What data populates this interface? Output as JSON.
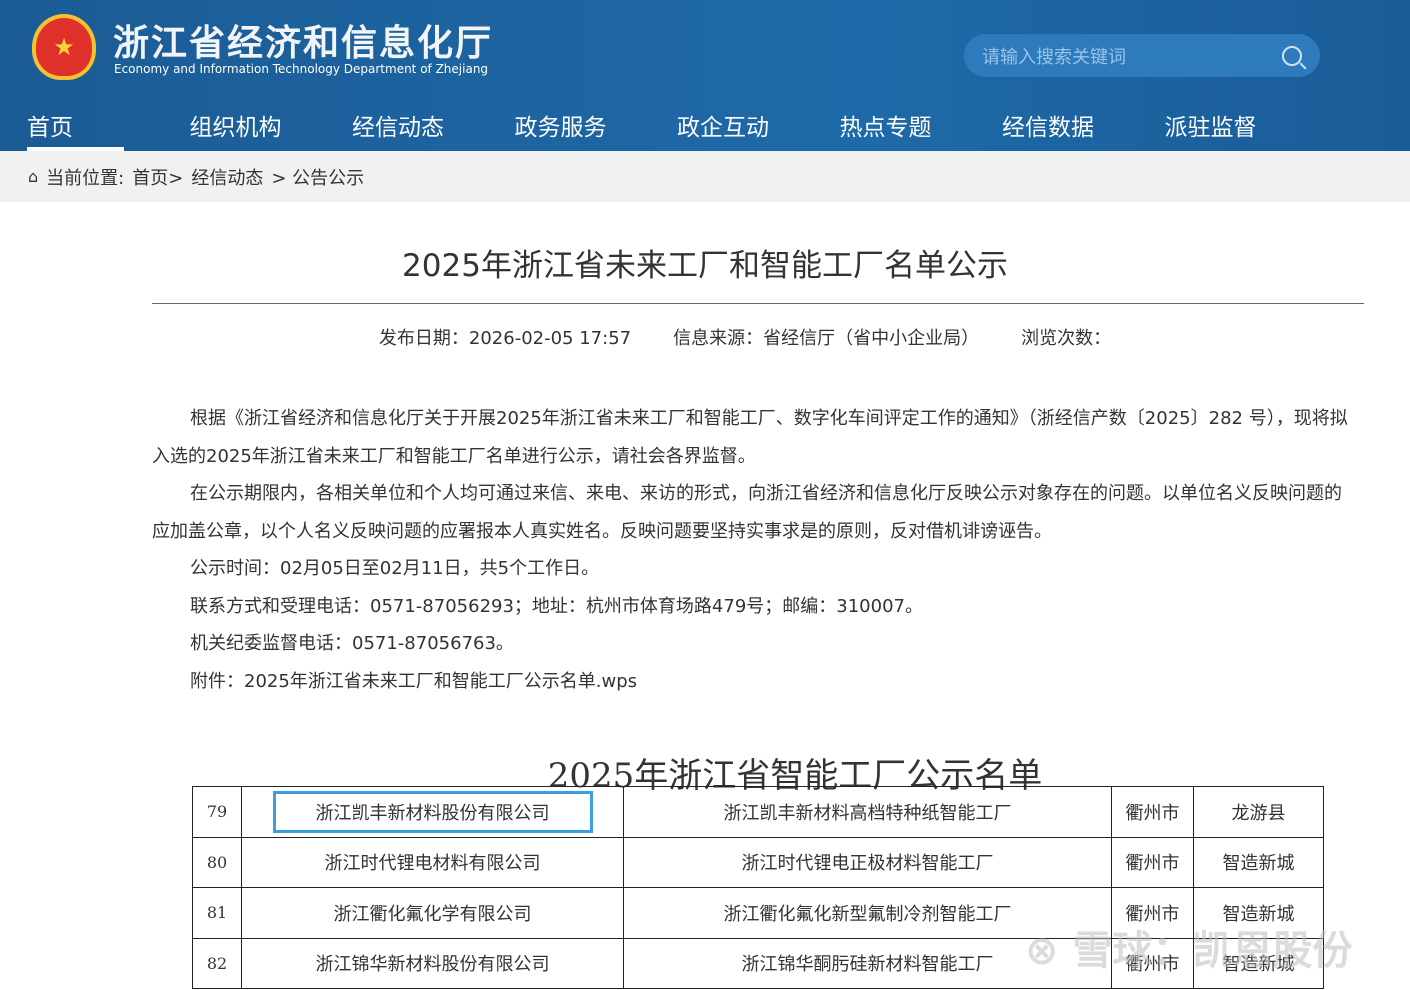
{
  "header": {
    "title": "浙江省经济和信息化厅",
    "subtitle": "Economy and Information Technology Department of Zhejiang",
    "search_placeholder": "请输入搜索关键词"
  },
  "nav": [
    "首页",
    "组织机构",
    "经信动态",
    "政务服务",
    "政企互动",
    "热点专题",
    "经信数据",
    "派驻监督"
  ],
  "breadcrumb": {
    "label": "当前位置:",
    "items": [
      "首页>",
      "经信动态",
      "> 公告公示"
    ]
  },
  "article": {
    "title": "2025年浙江省未来工厂和智能工厂名单公示",
    "date": "发布日期：2026-02-05 17:57",
    "source": "信息来源：省经信厅（省中小企业局）",
    "views": "浏览次数：",
    "paragraphs": [
      "根据《浙江省经济和信息化厅关于开展2025年浙江省未来工厂和智能工厂、数字化车间评定工作的通知》（浙经信产数〔2025〕282 号），现将拟入选的2025年浙江省未来工厂和智能工厂名单进行公示，请社会各界监督。",
      "在公示期限内，各相关单位和个人均可通过来信、来电、来访的形式，向浙江省经济和信息化厅反映公示对象存在的问题。以单位名义反映问题的应加盖公章，以个人名义反映问题的应署报本人真实姓名。反映问题要坚持实事求是的原则，反对借机诽谤诬告。",
      "公示时间：02月05日至02月11日，共5个工作日。",
      "联系方式和受理电话：0571-87056293；地址：杭州市体育场路479号；邮编：310007。",
      "机关纪委监督电话：0571-87056763。",
      "附件：2025年浙江省未来工厂和智能工厂公示名单.wps"
    ]
  },
  "list": {
    "title": "2025年浙江省智能工厂公示名单",
    "rows": [
      [
        "79",
        "浙江凯丰新材料股份有限公司",
        "浙江凯丰新材料高档特种纸智能工厂",
        "衢州市",
        "龙游县"
      ],
      [
        "80",
        "浙江时代锂电材料有限公司",
        "浙江时代锂电正极材料智能工厂",
        "衢州市",
        "智造新城"
      ],
      [
        "81",
        "浙江衢化氟化学有限公司",
        "浙江衢化氟化新型氟制冷剂智能工厂",
        "衢州市",
        "智造新城"
      ],
      [
        "82",
        "浙江锦华新材料股份有限公司",
        "浙江锦华酮肟硅新材料智能工厂",
        "衢州市",
        "智造新城"
      ]
    ]
  },
  "watermark": "雪球：凯恩股份"
}
